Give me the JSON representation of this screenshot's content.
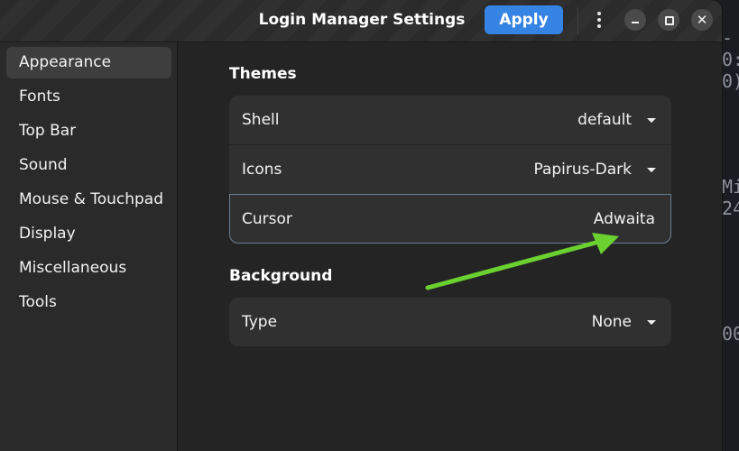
{
  "window": {
    "title": "Login Manager Settings",
    "apply_label": "Apply"
  },
  "sidebar": {
    "items": [
      {
        "label": "Appearance",
        "active": true
      },
      {
        "label": "Fonts"
      },
      {
        "label": "Top Bar"
      },
      {
        "label": "Sound"
      },
      {
        "label": "Mouse & Touchpad"
      },
      {
        "label": "Display"
      },
      {
        "label": "Miscellaneous"
      },
      {
        "label": "Tools"
      }
    ]
  },
  "themes": {
    "title": "Themes",
    "shell": {
      "label": "Shell",
      "value": "default"
    },
    "icons": {
      "label": "Icons",
      "value": "Papirus-Dark"
    },
    "cursor": {
      "label": "Cursor",
      "value": "Adwaita"
    }
  },
  "background": {
    "title": "Background",
    "type": {
      "label": "Type",
      "value": "None"
    }
  },
  "icons": {
    "menu": "vertical-dots-icon",
    "minimize": "minimize-icon",
    "maximize": "maximize-icon",
    "close": "close-icon",
    "dropdown": "caret-down-icon"
  },
  "colors": {
    "accent": "#3584e4",
    "annotation_arrow": "#6bd130",
    "focus_border": "#6c7f92"
  }
}
